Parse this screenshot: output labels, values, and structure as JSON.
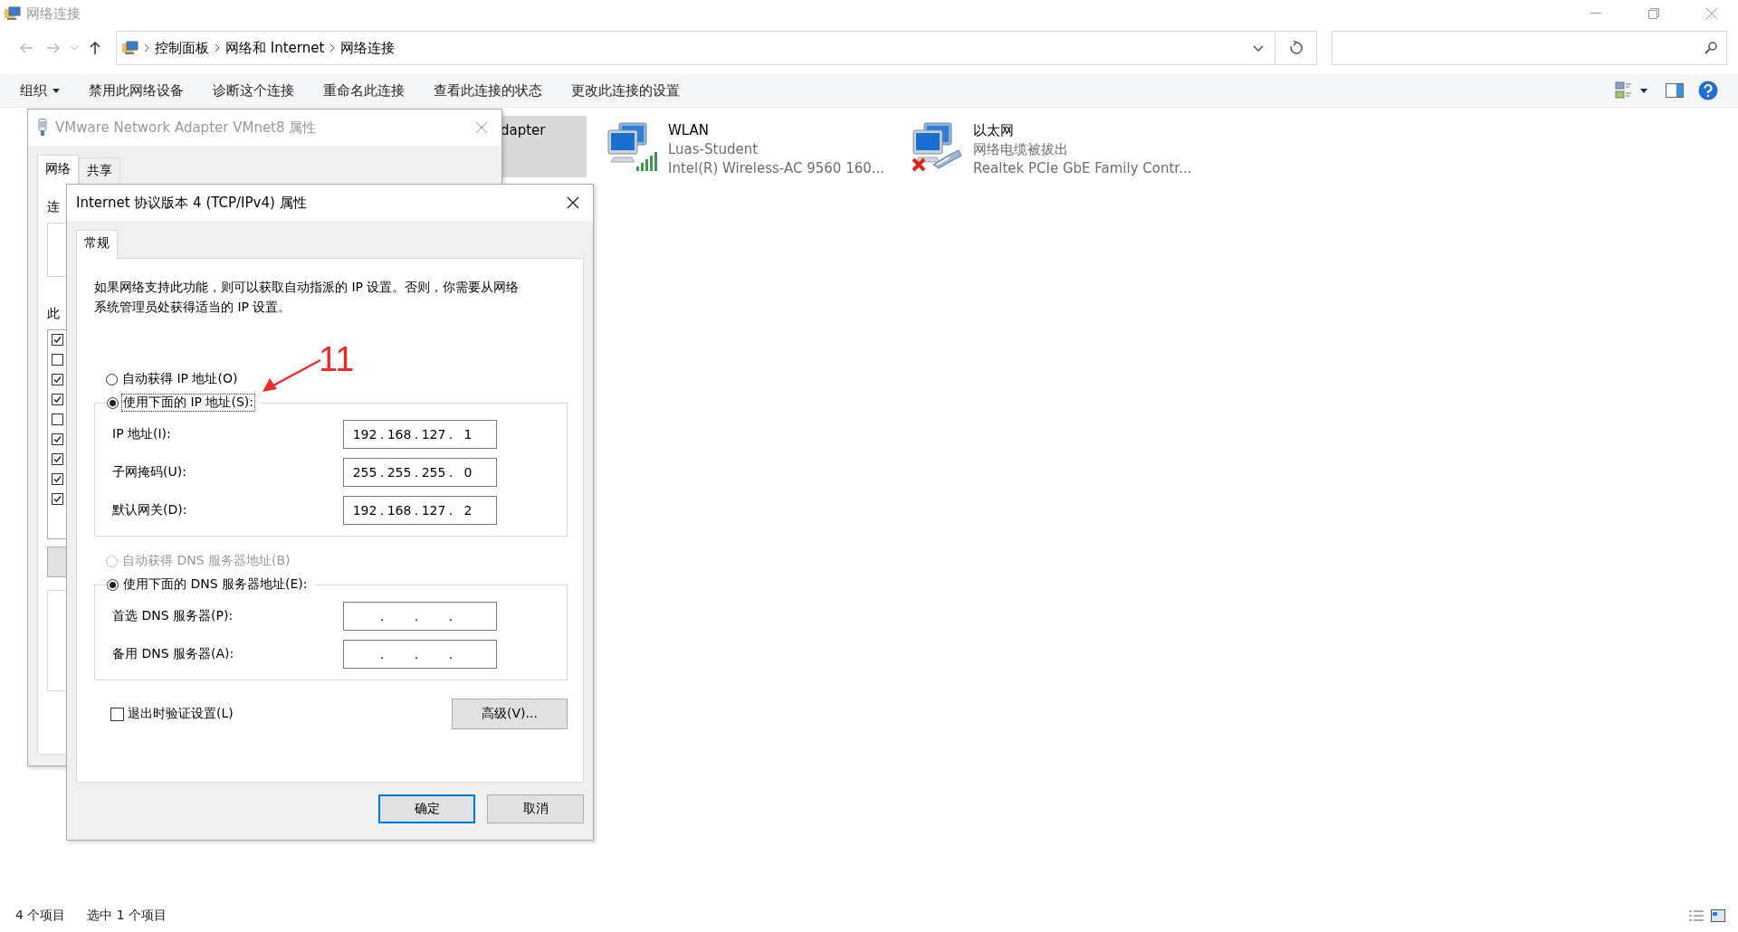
{
  "window": {
    "title": "网络连接"
  },
  "address": {
    "breadcrumbs": [
      "控制面板",
      "网络和 Internet",
      "网络连接"
    ]
  },
  "toolbar": {
    "items": [
      {
        "label": "组织",
        "kind": "menu"
      },
      {
        "label": "禁用此网络设备",
        "kind": "command"
      },
      {
        "label": "诊断这个连接",
        "kind": "command"
      },
      {
        "label": "重命名此连接",
        "kind": "command"
      },
      {
        "label": "查看此连接的状态",
        "kind": "command"
      },
      {
        "label": "更改此连接的设置",
        "kind": "command"
      }
    ]
  },
  "connections": [
    {
      "kind": "adapter",
      "name": "dapter",
      "selected": true
    },
    {
      "kind": "wifi",
      "name": "WLAN",
      "status": "Luas-Student",
      "device": "Intel(R) Wireless-AC 9560 160...",
      "selected": false
    },
    {
      "kind": "disconnected",
      "name": "以太网",
      "status": "网络电缆被拔出",
      "device": "Realtek PCIe GbE Family Contr...",
      "selected": false
    }
  ],
  "status_bar": {
    "count": "4 个项目",
    "selection": "选中 1 个项目"
  },
  "adapter_dialog": {
    "title": "VMware Network Adapter VMnet8 属性",
    "tabs": [
      {
        "label": "网络",
        "selected": true
      },
      {
        "label": "共享",
        "selected": false
      }
    ],
    "label_1": "连",
    "label_2": "此",
    "components": [
      {
        "checked": true
      },
      {
        "checked": false
      },
      {
        "checked": true
      },
      {
        "checked": true
      },
      {
        "checked": false
      },
      {
        "checked": true
      },
      {
        "checked": true
      },
      {
        "checked": true
      },
      {
        "checked": true
      }
    ]
  },
  "ipv4_dialog": {
    "title": "Internet 协议版本 4 (TCP/IPv4) 属性",
    "tabs": [
      {
        "label": "常规",
        "selected": true
      }
    ],
    "octet_separator": ".",
    "description": "如果网络支持此功能，则可以获取自动指派的 IP 设置。否则，你需要从网络系统管理员处获得适当的 IP 设置。",
    "ip_mode": [
      {
        "label": "自动获得 IP 地址(O)",
        "selected": false,
        "disabled": false,
        "focused": false
      },
      {
        "label": "使用下面的 IP 地址(S):",
        "selected": true,
        "disabled": false,
        "focused": true
      }
    ],
    "ip_fields": [
      {
        "label": "IP 地址(I):",
        "octets": [
          "192",
          "168",
          "127",
          "1"
        ]
      },
      {
        "label": "子网掩码(U):",
        "octets": [
          "255",
          "255",
          "255",
          "0"
        ]
      },
      {
        "label": "默认网关(D):",
        "octets": [
          "192",
          "168",
          "127",
          "2"
        ]
      }
    ],
    "dns_mode": [
      {
        "label": "自动获得 DNS 服务器地址(B)",
        "selected": false,
        "disabled": true,
        "focused": false
      },
      {
        "label": "使用下面的 DNS 服务器地址(E):",
        "selected": true,
        "disabled": false,
        "focused": false
      }
    ],
    "dns_fields": [
      {
        "label": "首选 DNS 服务器(P):"
      },
      {
        "label": "备用 DNS 服务器(A):"
      }
    ],
    "validate": {
      "label": "退出时验证设置(L)",
      "checked": false
    },
    "advanced_button": "高级(V)...",
    "buttons": [
      {
        "label": "确定",
        "default": true
      },
      {
        "label": "取消",
        "default": false
      }
    ]
  },
  "annotation": {
    "text": "11"
  }
}
